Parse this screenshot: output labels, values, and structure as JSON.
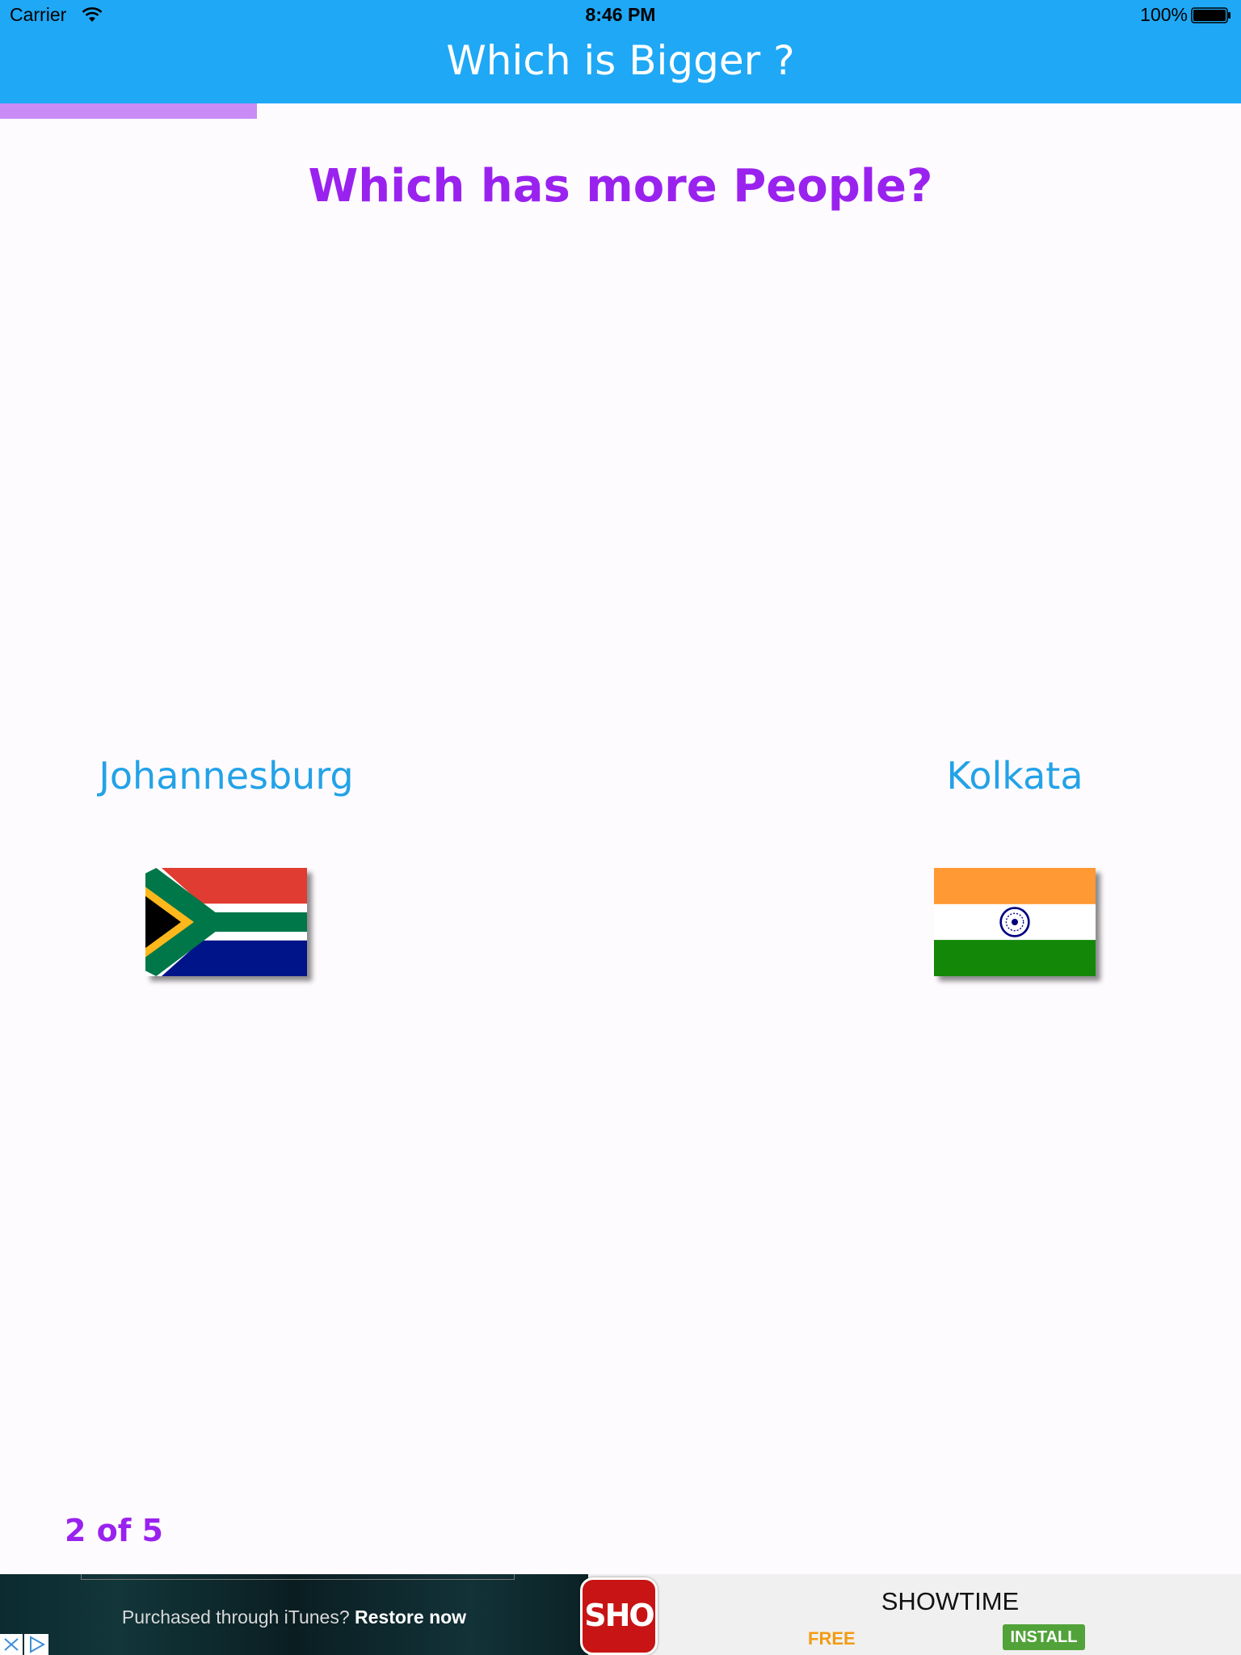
{
  "status_bar": {
    "carrier": "Carrier",
    "time": "8:46 PM",
    "battery": "100%",
    "wifi_icon": "wifi-icon",
    "battery_icon": "battery-icon"
  },
  "nav": {
    "title": "Which is Bigger ?"
  },
  "quiz": {
    "question": "Which has more People?",
    "progress": 0.207,
    "counter": "2 of 5",
    "choices": [
      {
        "name": "Johannesburg",
        "flag_icon": "south-africa-flag-icon"
      },
      {
        "name": "Kolkata",
        "flag_icon": "india-flag-icon"
      }
    ]
  },
  "ad": {
    "restore_prefix": "Purchased through iTunes?",
    "restore_link": "Restore now",
    "app_icon_label": "SHO",
    "app_name": "SHOWTIME",
    "price": "FREE",
    "install_label": "INSTALL"
  },
  "colors": {
    "nav_bar": "#1fa8f5",
    "progress_fill": "#c98cf7",
    "question_text": "#9a22ef",
    "choice_text": "#23a2e8",
    "background": "#fefbfe"
  }
}
